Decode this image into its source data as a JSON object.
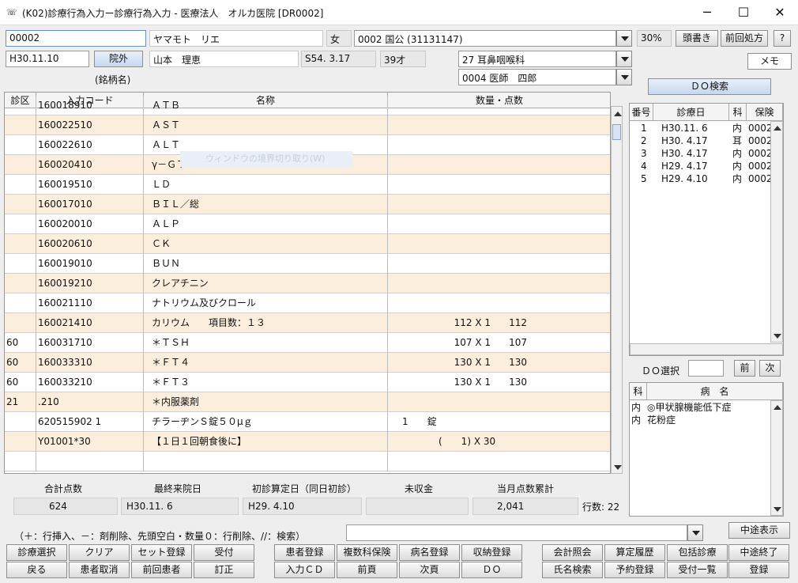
{
  "window": {
    "title": "(K02)診療行為入力ー診療行為入力 - 医療法人　オルカ医院 [DR0002]",
    "minimize_icon": "─",
    "maximize_icon": "☐",
    "close_icon": "✕"
  },
  "patient": {
    "id": "00002",
    "kana": "ヤマモト　リエ",
    "sex": "女",
    "insurance": "0002 国公 (31131147)",
    "ratio": "30%",
    "date": "H30.11.10",
    "outpatient": "院外",
    "name": "山本　理恵",
    "birth": "S54. 3.17",
    "age": "39才",
    "department": "27 耳鼻咽喉科",
    "doctor": "0004 医師　四郎",
    "brand_label": "(銘柄名)"
  },
  "top_buttons": {
    "header": "頭書き",
    "prev_rx": "前回処方",
    "help": "?",
    "memo": "メモ",
    "do_search": "ＤＯ検索"
  },
  "grid": {
    "headers": [
      "診区",
      "入力コード",
      "名称",
      "数量・点数"
    ],
    "rows": [
      {
        "ku": "",
        "code": "160018910",
        "name": "ＡＴＢ",
        "qty": "",
        "pts": ""
      },
      {
        "ku": "",
        "code": "160022510",
        "name": "ＡＳＴ",
        "qty": "",
        "pts": ""
      },
      {
        "ku": "",
        "code": "160022610",
        "name": "ＡＬＴ",
        "qty": "",
        "pts": ""
      },
      {
        "ku": "",
        "code": "160020410",
        "name": "γ－ＧＴ",
        "qty": "",
        "pts": ""
      },
      {
        "ku": "",
        "code": "160019510",
        "name": "ＬＤ",
        "qty": "",
        "pts": ""
      },
      {
        "ku": "",
        "code": "160017010",
        "name": "ＢＩＬ／総",
        "qty": "",
        "pts": ""
      },
      {
        "ku": "",
        "code": "160020010",
        "name": "ＡＬＰ",
        "qty": "",
        "pts": ""
      },
      {
        "ku": "",
        "code": "160020610",
        "name": "ＣＫ",
        "qty": "",
        "pts": ""
      },
      {
        "ku": "",
        "code": "160019010",
        "name": "ＢＵＮ",
        "qty": "",
        "pts": ""
      },
      {
        "ku": "",
        "code": "160019210",
        "name": "クレアチニン",
        "qty": "",
        "pts": ""
      },
      {
        "ku": "",
        "code": "160021110",
        "name": "ナトリウム及びクロール",
        "qty": "",
        "pts": ""
      },
      {
        "ku": "",
        "code": "160021410",
        "name": "カリウム　　項目数：１３",
        "qty": "112 X 1",
        "pts": "112"
      },
      {
        "ku": "60",
        "code": "160031710",
        "name": "＊ＴＳＨ",
        "qty": "107 X 1",
        "pts": "107"
      },
      {
        "ku": "60",
        "code": "160033310",
        "name": "＊ＦＴ４",
        "qty": "130 X 1",
        "pts": "130"
      },
      {
        "ku": "60",
        "code": "160033210",
        "name": "＊ＦＴ３",
        "qty": "130 X 1",
        "pts": "130"
      },
      {
        "ku": "21",
        "code": ".210",
        "name": "＊内服薬剤",
        "qty": "",
        "pts": ""
      },
      {
        "ku": "",
        "code": "620515902 1",
        "name": "チラーヂンＳ錠５０μｇ",
        "qty": "1　　錠",
        "pts": ""
      },
      {
        "ku": "",
        "code": "Y01001*30",
        "name": "【１日１回朝食後に】",
        "qty": "(　　1) X 30",
        "pts": ""
      },
      {
        "ku": "",
        "code": "",
        "name": "",
        "qty": "",
        "pts": ""
      }
    ],
    "ghost_tooltip": "ウィンドウの境界切り取り(W)"
  },
  "history": {
    "headers": [
      "番号",
      "診療日",
      "科",
      "保険"
    ],
    "rows": [
      {
        "no": "1",
        "date": "H30.11. 6",
        "ka": "内",
        "ins": "0002"
      },
      {
        "no": "2",
        "date": "H30. 4.17",
        "ka": "耳",
        "ins": "0002"
      },
      {
        "no": "3",
        "date": "H30. 4.17",
        "ka": "内",
        "ins": "0002"
      },
      {
        "no": "4",
        "date": "H29. 4.17",
        "ka": "内",
        "ins": "0002"
      },
      {
        "no": "5",
        "date": "H29. 4.10",
        "ka": "内",
        "ins": "0002"
      }
    ],
    "do_select_label": "ＤＯ選択",
    "prev": "前",
    "next": "次"
  },
  "disease": {
    "headers": [
      "科",
      "病　名"
    ],
    "rows": [
      {
        "ka": "内",
        "name": "◎甲状腺機能低下症"
      },
      {
        "ka": "内",
        "name": "花粉症"
      }
    ]
  },
  "summary": {
    "labels": [
      "合計点数",
      "最終来院日",
      "初診算定日（同日初診）",
      "未収金",
      "当月点数累計"
    ],
    "values": [
      "624",
      "H30.11. 6",
      "H29. 4.10",
      "",
      "2,041"
    ],
    "rows_count": "行数: 22"
  },
  "hint": "（＋：行挿入、－：剤削除、先頭空白・数量０：行削除、//：検索）",
  "mid_display": "中途表示",
  "fkeys": {
    "row1": [
      "診療選択",
      "クリア",
      "セット登録",
      "受付",
      "患者登録",
      "複数科保険",
      "病名登録",
      "収納登録",
      "会計照会",
      "算定履歴",
      "包括診療",
      "中途終了"
    ],
    "row2": [
      "戻る",
      "患者取消",
      "前回患者",
      "訂正",
      "入力ＣＤ",
      "前頁",
      "次頁",
      "ＤＯ",
      "氏名検索",
      "予約登録",
      "受付一覧",
      "登録"
    ]
  }
}
